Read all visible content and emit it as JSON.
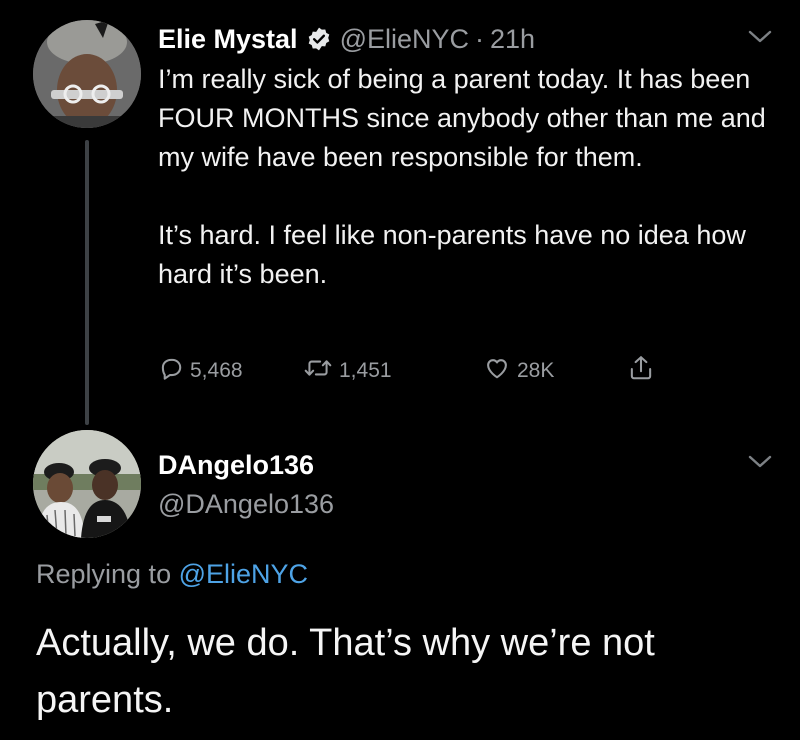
{
  "colors": {
    "background": "#000000",
    "text_primary": "#e7e9ea",
    "text_secondary": "#9a9da1",
    "link": "#4ea3e6",
    "thread_line": "#3d4145"
  },
  "tweet": {
    "author_name": "Elie Mystal",
    "verified": true,
    "handle": "@ElieNYC",
    "separator": "·",
    "time": "21h",
    "paragraphs": [
      "I’m really sick of being a parent today. It has been FOUR MONTHS since anybody other than me and my wife have been responsible for them.",
      "It’s hard. I feel like non-parents have no idea how hard it’s been."
    ],
    "actions": {
      "replies": "5,468",
      "retweets": "1,451",
      "likes": "28K"
    },
    "icons": {
      "verified": "verified-badge-icon",
      "more": "chevron-down-icon",
      "reply": "reply-bubble-icon",
      "retweet": "retweet-icon",
      "like": "heart-icon",
      "share": "share-icon"
    }
  },
  "reply": {
    "author_name": "DAngelo136",
    "handle": "@DAngelo136",
    "replying_label": "Replying to",
    "replying_to": "@ElieNYC",
    "text": "Actually, we do. That’s why we’re not parents."
  }
}
